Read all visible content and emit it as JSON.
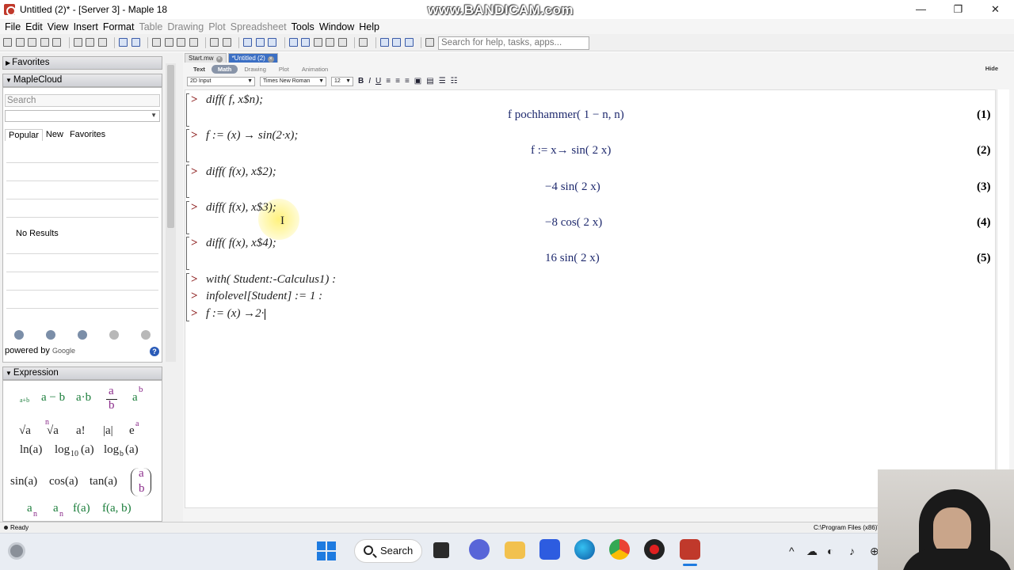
{
  "window": {
    "title": "Untitled (2)* - [Server 3] - Maple 18",
    "watermark": "www.BANDICAM.com",
    "minimize": "—",
    "maximize": "❐",
    "close": "✕"
  },
  "menu": {
    "items": [
      {
        "label": "File",
        "disabled": false
      },
      {
        "label": "Edit",
        "disabled": false
      },
      {
        "label": "View",
        "disabled": false
      },
      {
        "label": "Insert",
        "disabled": false
      },
      {
        "label": "Format",
        "disabled": false
      },
      {
        "label": "Table",
        "disabled": true
      },
      {
        "label": "Drawing",
        "disabled": true
      },
      {
        "label": "Plot",
        "disabled": true
      },
      {
        "label": "Spreadsheet",
        "disabled": true
      },
      {
        "label": "Tools",
        "disabled": false
      },
      {
        "label": "Window",
        "disabled": false
      },
      {
        "label": "Help",
        "disabled": false
      }
    ]
  },
  "toolbar": {
    "search_placeholder": "Search for help, tasks, apps..."
  },
  "sidebar": {
    "favorites_label": "Favorites",
    "maplecloud_label": "MapleCloud",
    "search_placeholder": "Search",
    "tabs": [
      "Popular",
      "New",
      "Favorites"
    ],
    "no_results": "No Results",
    "powered_by": "powered by",
    "google": "Google",
    "help": "?",
    "expression_label": "Expression"
  },
  "palette": {
    "row1": {
      "apb": "a+b",
      "amb": "a − b",
      "atb": "a·b",
      "frac_num": "a",
      "frac_den": "b",
      "pow_base": "a",
      "pow_exp": "b"
    },
    "row2": {
      "sqrt": "√a",
      "nroot_n": "n",
      "nroot": "√a",
      "fact": "a!",
      "abs": "|a|",
      "exp_base": "e",
      "exp_exp": "a"
    },
    "row3": {
      "ln": "ln(a)",
      "log10": "log",
      "log10_sub": "10",
      "log10_arg": "(a)",
      "logb": "log",
      "logb_sub": "b",
      "logb_arg": "(a)"
    },
    "row4": {
      "sin": "sin(a)",
      "cos": "cos(a)",
      "tan": "tan(a)",
      "binom_top": "a",
      "binom_bot": "b"
    },
    "row5": {
      "an_base": "a",
      "an_sub": "n",
      "an2_base": "a",
      "an2_sub": "n",
      "fa": "f(a)",
      "fab": "f(a, b)"
    }
  },
  "doc": {
    "tabs": [
      "Start.mw",
      "*Untitled (2)"
    ],
    "modes": [
      "Text",
      "Math",
      "Drawing",
      "Plot",
      "Animation"
    ],
    "active_mode": "Math",
    "hide": "Hide",
    "input_style": "2D Input",
    "font": "Times New Roman",
    "size": "12",
    "bold": "B",
    "italic": "I",
    "underline": "U"
  },
  "worksheet": {
    "prompt": ">",
    "inputs": [
      "diff( f, x$n);",
      "f := (x) → sin(2·x);",
      "diff( f(x), x$2);",
      "diff( f(x), x$3);",
      "diff( f(x), x$4);",
      "with( Student:-Calculus1) :",
      "infolevel[Student] := 1 :",
      "f := (x) →2·"
    ],
    "outputs": [
      {
        "text": "f pochhammer( 1 − n, n)",
        "label": "(1)"
      },
      {
        "text": "f := x→ sin( 2 x)",
        "label": "(2)"
      },
      {
        "text": "−4 sin( 2 x)",
        "label": "(3)"
      },
      {
        "text": "−8 cos( 2 x)",
        "label": "(4)"
      },
      {
        "text": "16 sin( 2 x)",
        "label": "(5)"
      }
    ]
  },
  "status": {
    "left": "Ready",
    "right": "C:\\Program Files (x86)\\Ma"
  },
  "taskbar": {
    "search_label": "Search"
  }
}
